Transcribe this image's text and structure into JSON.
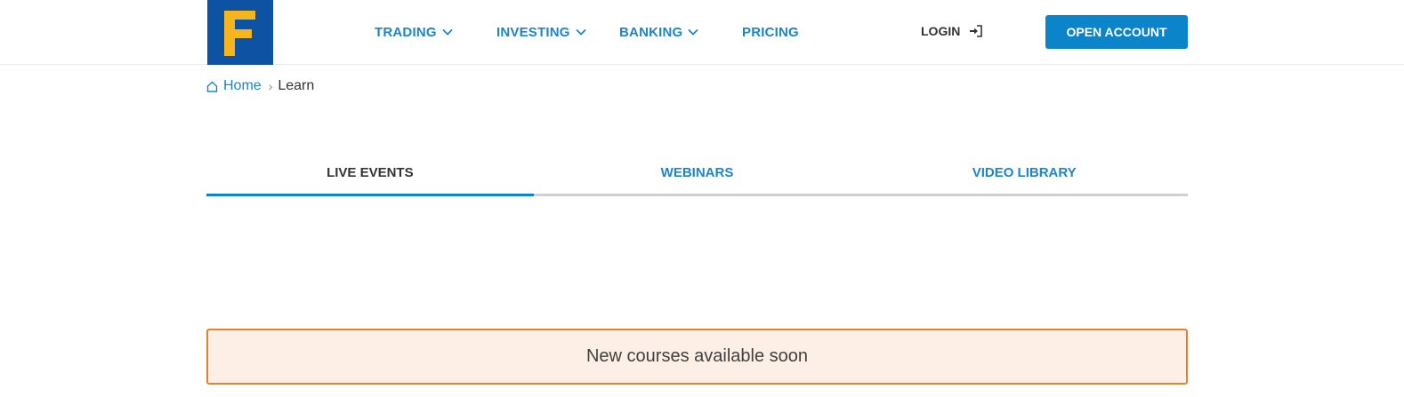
{
  "header": {
    "logo_letter": "F",
    "nav": [
      {
        "label": "TRADING",
        "has_dropdown": true
      },
      {
        "label": "INVESTING",
        "has_dropdown": true
      },
      {
        "label": "BANKING",
        "has_dropdown": true
      },
      {
        "label": "PRICING",
        "has_dropdown": false
      }
    ],
    "login_label": "LOGIN",
    "open_account_label": "OPEN ACCOUNT"
  },
  "breadcrumb": {
    "home": "Home",
    "separator": "›",
    "current": "Learn"
  },
  "tabs": [
    {
      "label": "LIVE EVENTS",
      "active": true
    },
    {
      "label": "WEBINARS",
      "active": false
    },
    {
      "label": "VIDEO LIBRARY",
      "active": false
    }
  ],
  "notice": {
    "text": "New courses available soon"
  },
  "colors": {
    "brand_blue": "#0d52a3",
    "logo_yellow": "#f6b51c",
    "accent": "#0b84c9",
    "link": "#1a86c8",
    "notice_bg": "#fdefe6",
    "notice_border": "#e5822e"
  },
  "icons": {
    "nav_dropdown": "chevron-down-icon",
    "login": "sign-in-icon",
    "home": "home-icon"
  }
}
